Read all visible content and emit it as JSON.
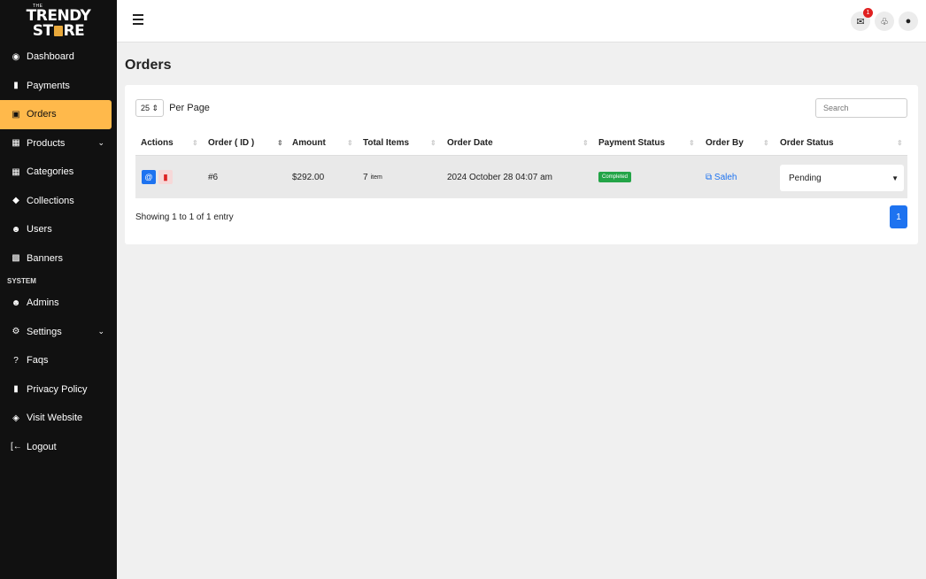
{
  "brand": {
    "small": "THE",
    "line1": "TRENDY",
    "line2a": "ST",
    "line2b": "RE"
  },
  "sidebar": {
    "items": [
      {
        "label": "Dashboard"
      },
      {
        "label": "Payments"
      },
      {
        "label": "Orders"
      },
      {
        "label": "Products"
      },
      {
        "label": "Categories"
      },
      {
        "label": "Collections"
      },
      {
        "label": "Users"
      },
      {
        "label": "Banners"
      }
    ],
    "section_label": "SYSTEM",
    "system_items": [
      {
        "label": "Admins"
      },
      {
        "label": "Settings"
      },
      {
        "label": "Faqs"
      },
      {
        "label": "Privacy Policy"
      },
      {
        "label": "Visit Website"
      },
      {
        "label": "Logout"
      }
    ]
  },
  "header": {
    "notification_count": "1"
  },
  "page": {
    "title": "Orders"
  },
  "table": {
    "per_page_value": "25",
    "per_page_label": "Per Page",
    "search_placeholder": "Search",
    "columns": [
      "Actions",
      "Order ( ID )",
      "Amount",
      "Total Items",
      "Order Date",
      "Payment Status",
      "Order By",
      "Order Status"
    ],
    "rows": [
      {
        "id": "#6",
        "amount": "$292.00",
        "items": "7",
        "items_unit": "item",
        "date": "2024 October 28 04:07 am",
        "payment_status": "Completed",
        "order_by": "Saleh",
        "order_status": "Pending"
      }
    ],
    "summary": "Showing 1 to 1 of 1 entry",
    "current_page": "1"
  },
  "colors": {
    "sidebar": "#111111",
    "active": "#ffb94b",
    "primary": "#1e73f0",
    "success": "#23a447"
  }
}
